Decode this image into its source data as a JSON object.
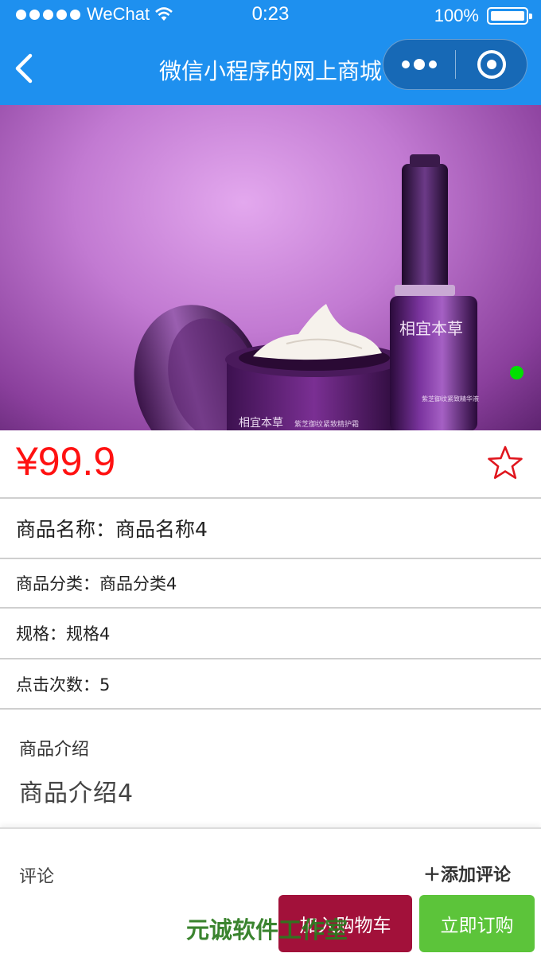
{
  "status_bar": {
    "carrier": "WeChat",
    "time": "0:23",
    "battery": "100%"
  },
  "nav": {
    "title": "微信小程序的网上商城"
  },
  "banner": {
    "slide_count_indicator": 1
  },
  "product": {
    "price": "¥99.9",
    "name_line": "商品名称：商品名称4",
    "category_line": "商品分类：商品分类4",
    "spec_line": "规格：规格4",
    "clicks_line": "点击次数：5",
    "intro_label": "商品介绍",
    "intro_text": "商品介绍4"
  },
  "comments": {
    "label": "评论",
    "add_label": "＋添加评论"
  },
  "actions": {
    "add_to_cart": "加入购物车",
    "buy_now": "立即订购"
  },
  "watermark": "元诚软件工作室",
  "colors": {
    "header": "#1e90ef",
    "price": "#ff1111",
    "cart_button": "#a2113a",
    "buy_button": "#5cc43a"
  }
}
